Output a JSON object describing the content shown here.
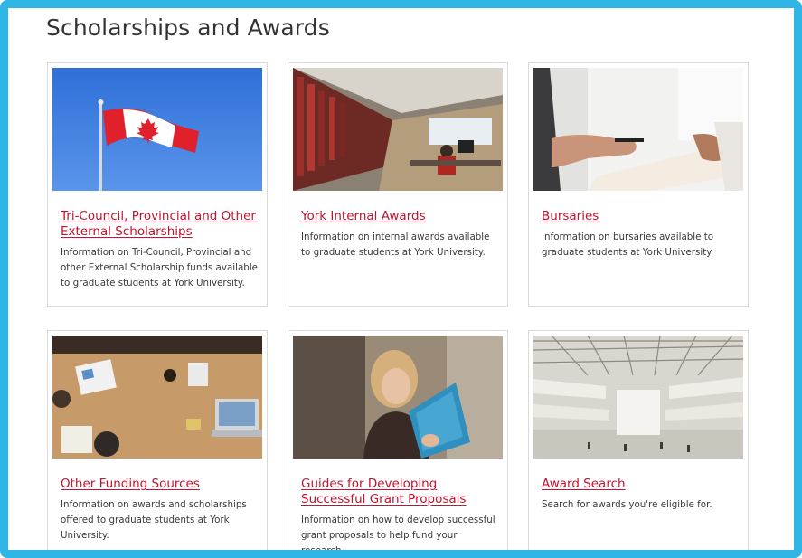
{
  "page": {
    "title": "Scholarships and Awards"
  },
  "cards": [
    {
      "title": "Tri-Council, Provincial and Other External Scholarships",
      "description": "Information on Tri-Council, Provincial and other External Scholarship funds available to graduate students at York University.",
      "image": "canadian-flag"
    },
    {
      "title": "York Internal Awards",
      "description": "Information on internal awards available to graduate students at York University.",
      "image": "library-study-area"
    },
    {
      "title": "Bursaries",
      "description": "Information on bursaries available to graduate students at York University.",
      "image": "handing-document"
    },
    {
      "title": "Other Funding Sources",
      "description": "Information on awards and scholarships offered to graduate students at York University.",
      "image": "meeting-table"
    },
    {
      "title": "Guides for Developing Successful Grant Proposals",
      "description": "Information on how to develop successful grant proposals to help fund your research.",
      "image": "woman-reading"
    },
    {
      "title": "Award Search",
      "description": "Search for awards you're eligible for.",
      "image": "atrium-building"
    }
  ],
  "colors": {
    "frame_border": "#2fb6e6",
    "link": "#c4122f",
    "heading": "#333333"
  }
}
